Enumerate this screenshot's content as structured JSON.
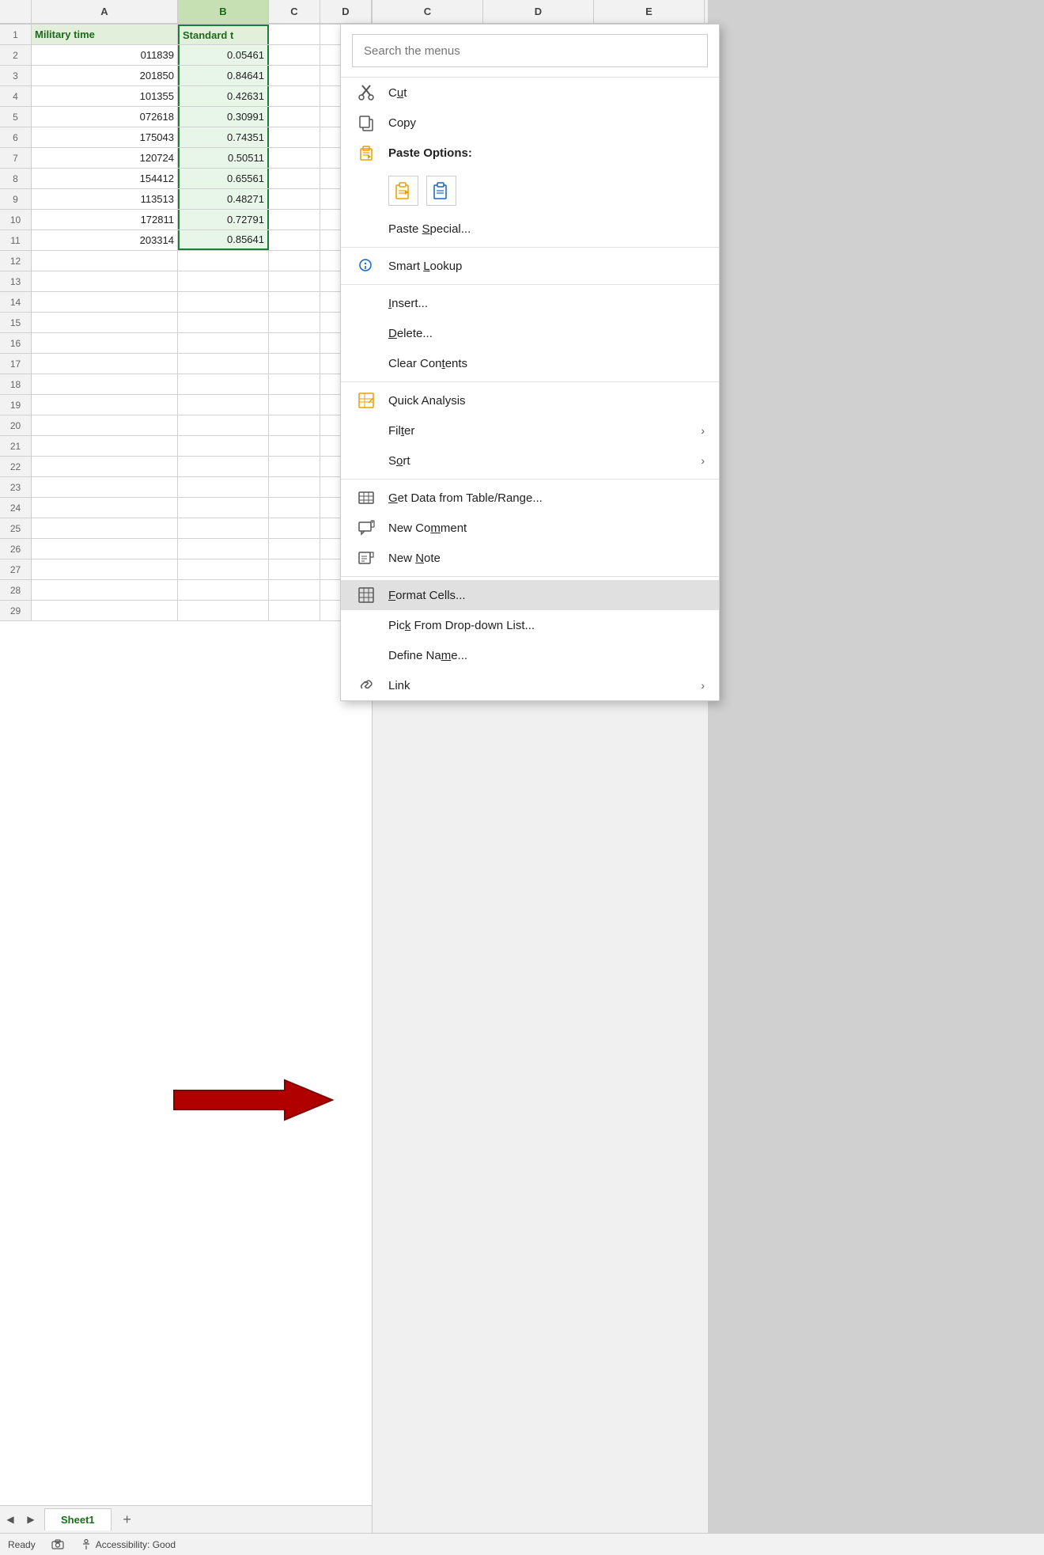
{
  "spreadsheet": {
    "columns": [
      "A",
      "B",
      "C",
      "D",
      "E"
    ],
    "col_headers": [
      "A",
      "B",
      "C",
      "D",
      "E"
    ],
    "rows": [
      {
        "num": 1,
        "a": "Military time",
        "b": "Standard t",
        "c": "",
        "d": ""
      },
      {
        "num": 2,
        "a": "011839",
        "b": "0.05461",
        "c": "",
        "d": ""
      },
      {
        "num": 3,
        "a": "201850",
        "b": "0.84641",
        "c": "",
        "d": ""
      },
      {
        "num": 4,
        "a": "101355",
        "b": "0.42631",
        "c": "",
        "d": ""
      },
      {
        "num": 5,
        "a": "072618",
        "b": "0.30991",
        "c": "",
        "d": ""
      },
      {
        "num": 6,
        "a": "175043",
        "b": "0.74351",
        "c": "",
        "d": ""
      },
      {
        "num": 7,
        "a": "120724",
        "b": "0.50511",
        "c": "",
        "d": ""
      },
      {
        "num": 8,
        "a": "154412",
        "b": "0.65561",
        "c": "",
        "d": ""
      },
      {
        "num": 9,
        "a": "113513",
        "b": "0.48271",
        "c": "",
        "d": ""
      },
      {
        "num": 10,
        "a": "172811",
        "b": "0.72791",
        "c": "",
        "d": ""
      },
      {
        "num": 11,
        "a": "203314",
        "b": "0.85641",
        "c": "",
        "d": ""
      },
      {
        "num": 12,
        "a": "",
        "b": "",
        "c": "",
        "d": ""
      },
      {
        "num": 13,
        "a": "",
        "b": "",
        "c": "",
        "d": ""
      },
      {
        "num": 14,
        "a": "",
        "b": "",
        "c": "",
        "d": ""
      },
      {
        "num": 15,
        "a": "",
        "b": "",
        "c": "",
        "d": ""
      },
      {
        "num": 16,
        "a": "",
        "b": "",
        "c": "",
        "d": ""
      },
      {
        "num": 17,
        "a": "",
        "b": "",
        "c": "",
        "d": ""
      },
      {
        "num": 18,
        "a": "",
        "b": "",
        "c": "",
        "d": ""
      },
      {
        "num": 19,
        "a": "",
        "b": "",
        "c": "",
        "d": ""
      },
      {
        "num": 20,
        "a": "",
        "b": "",
        "c": "",
        "d": ""
      },
      {
        "num": 21,
        "a": "",
        "b": "",
        "c": "",
        "d": ""
      },
      {
        "num": 22,
        "a": "",
        "b": "",
        "c": "",
        "d": ""
      },
      {
        "num": 23,
        "a": "",
        "b": "",
        "c": "",
        "d": ""
      },
      {
        "num": 24,
        "a": "",
        "b": "",
        "c": "",
        "d": ""
      },
      {
        "num": 25,
        "a": "",
        "b": "",
        "c": "",
        "d": ""
      },
      {
        "num": 26,
        "a": "",
        "b": "",
        "c": "",
        "d": ""
      },
      {
        "num": 27,
        "a": "",
        "b": "",
        "c": "",
        "d": ""
      },
      {
        "num": 28,
        "a": "",
        "b": "",
        "c": "",
        "d": ""
      },
      {
        "num": 29,
        "a": "",
        "b": "",
        "c": "",
        "d": ""
      }
    ],
    "tab": "Sheet1",
    "status": {
      "ready": "Ready",
      "accessibility": "Accessibility: Good"
    }
  },
  "context_menu": {
    "search_placeholder": "Search the menus",
    "items": [
      {
        "id": "cut",
        "label": "Cut",
        "icon": "cut",
        "has_arrow": false,
        "divider_after": false
      },
      {
        "id": "copy",
        "label": "Copy",
        "icon": "copy",
        "has_arrow": false,
        "divider_after": false
      },
      {
        "id": "paste-options",
        "label": "Paste Options:",
        "icon": "paste",
        "has_arrow": false,
        "is_paste_header": true,
        "divider_after": false
      },
      {
        "id": "paste-special",
        "label": "Paste Special...",
        "icon": "",
        "has_arrow": false,
        "divider_after": true
      },
      {
        "id": "smart-lookup",
        "label": "Smart Lookup",
        "icon": "lookup",
        "has_arrow": false,
        "divider_after": true
      },
      {
        "id": "insert",
        "label": "Insert...",
        "icon": "",
        "has_arrow": false,
        "divider_after": false
      },
      {
        "id": "delete",
        "label": "Delete...",
        "icon": "",
        "has_arrow": false,
        "divider_after": false
      },
      {
        "id": "clear-contents",
        "label": "Clear Contents",
        "icon": "",
        "has_arrow": false,
        "divider_after": true
      },
      {
        "id": "quick-analysis",
        "label": "Quick Analysis",
        "icon": "analysis",
        "has_arrow": false,
        "divider_after": false
      },
      {
        "id": "filter",
        "label": "Filter",
        "icon": "",
        "has_arrow": true,
        "divider_after": false
      },
      {
        "id": "sort",
        "label": "Sort",
        "icon": "",
        "has_arrow": true,
        "divider_after": true
      },
      {
        "id": "get-data",
        "label": "Get Data from Table/Range...",
        "icon": "table",
        "has_arrow": false,
        "divider_after": false
      },
      {
        "id": "new-comment",
        "label": "New Comment",
        "icon": "comment",
        "has_arrow": false,
        "divider_after": false
      },
      {
        "id": "new-note",
        "label": "New Note",
        "icon": "note",
        "has_arrow": false,
        "divider_after": true
      },
      {
        "id": "format-cells",
        "label": "Format Cells...",
        "icon": "format",
        "has_arrow": false,
        "highlighted": true,
        "divider_after": false
      },
      {
        "id": "pick-from-dropdown",
        "label": "Pick From Drop-down List...",
        "icon": "",
        "has_arrow": false,
        "divider_after": false
      },
      {
        "id": "define-name",
        "label": "Define Name...",
        "icon": "",
        "has_arrow": false,
        "divider_after": false
      },
      {
        "id": "link",
        "label": "Link",
        "icon": "link",
        "has_arrow": true,
        "divider_after": false
      }
    ],
    "colors": {
      "highlight_bg": "#e0e0e0",
      "icon_orange": "#e8a000",
      "icon_blue": "#1565c0",
      "icon_teal": "#0097a7"
    }
  },
  "arrow": {
    "color": "#c0000"
  }
}
